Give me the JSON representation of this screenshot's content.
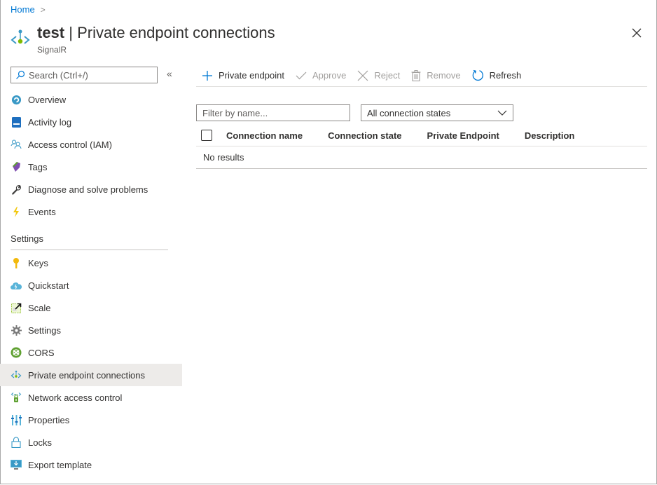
{
  "breadcrumb": {
    "items": [
      {
        "label": "Home"
      }
    ]
  },
  "header": {
    "resource_name": "test",
    "separator": " | ",
    "page_title": "Private endpoint connections",
    "subtitle": "SignalR"
  },
  "sidebar": {
    "search_placeholder": "Search (Ctrl+/)",
    "collapse_label": "«",
    "items": [
      {
        "label": "Overview",
        "icon": "overview-icon"
      },
      {
        "label": "Activity log",
        "icon": "activity-log-icon"
      },
      {
        "label": "Access control (IAM)",
        "icon": "iam-icon"
      },
      {
        "label": "Tags",
        "icon": "tag-icon"
      },
      {
        "label": "Diagnose and solve problems",
        "icon": "wrench-icon"
      },
      {
        "label": "Events",
        "icon": "lightning-icon"
      }
    ],
    "section_title": "Settings",
    "settings_items": [
      {
        "label": "Keys",
        "icon": "key-icon"
      },
      {
        "label": "Quickstart",
        "icon": "quickstart-cloud-icon"
      },
      {
        "label": "Scale",
        "icon": "scale-icon"
      },
      {
        "label": "Settings",
        "icon": "gear-icon"
      },
      {
        "label": "CORS",
        "icon": "cors-icon"
      },
      {
        "label": "Private endpoint connections",
        "icon": "private-endpoint-icon",
        "active": true
      },
      {
        "label": "Network access control",
        "icon": "network-lock-icon"
      },
      {
        "label": "Properties",
        "icon": "properties-icon"
      },
      {
        "label": "Locks",
        "icon": "lock-icon"
      },
      {
        "label": "Export template",
        "icon": "export-template-icon"
      }
    ]
  },
  "toolbar": {
    "add_private_endpoint": "Private endpoint",
    "approve": "Approve",
    "reject": "Reject",
    "remove": "Remove",
    "refresh": "Refresh"
  },
  "filter": {
    "placeholder": "Filter by name...",
    "value": ""
  },
  "state_dropdown": {
    "selected": "All connection states"
  },
  "table": {
    "columns": [
      "Connection name",
      "Connection state",
      "Private Endpoint",
      "Description"
    ],
    "rows": [],
    "empty_text": "No results"
  },
  "colors": {
    "accent": "#0078d4",
    "active_nav": "#edebe9",
    "disabled_text": "#a19f9d"
  }
}
